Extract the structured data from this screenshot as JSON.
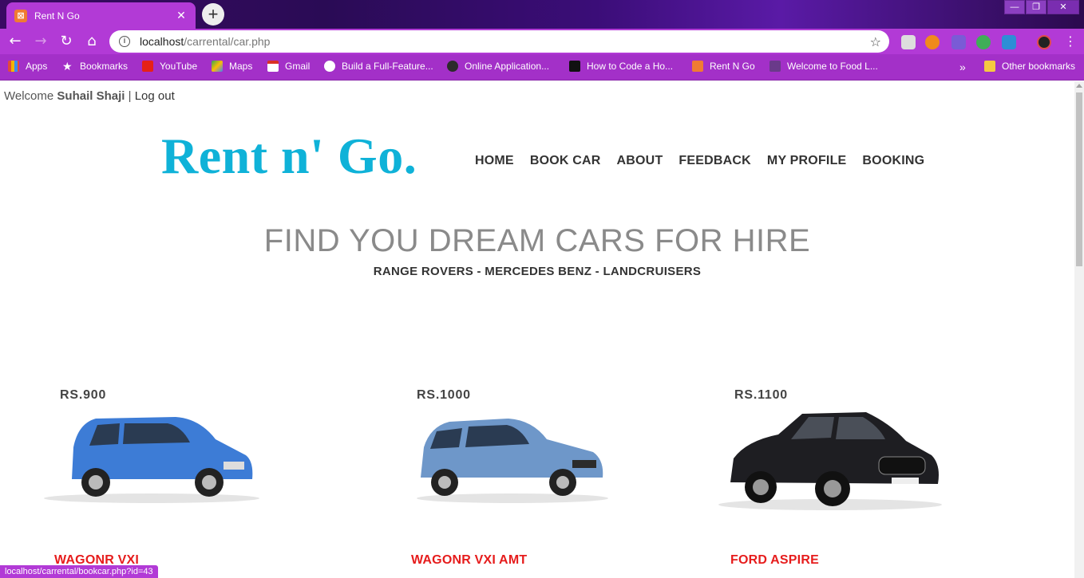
{
  "browser": {
    "tab_title": "Rent N Go",
    "url_host": "localhost",
    "url_path": "/carrental/car.php",
    "status_url": "localhost/carrental/bookcar.php?id=43",
    "bookmarks": [
      "Apps",
      "Bookmarks",
      "YouTube",
      "Maps",
      "Gmail",
      "Build a Full-Feature...",
      "Online Application...",
      "How to Code a Ho...",
      "Rent N Go",
      "Welcome to Food L...",
      "Other bookmarks"
    ],
    "overflow_label": "»"
  },
  "user": {
    "welcome_label": "Welcome",
    "name": "Suhail Shaji",
    "separator": "|",
    "logout_label": "Log out"
  },
  "site": {
    "logo": "Rent n' Go.",
    "nav": [
      "HOME",
      "BOOK CAR",
      "ABOUT",
      "FEEDBACK",
      "MY PROFILE",
      "BOOKING"
    ]
  },
  "hero": {
    "title": "FIND YOU DREAM CARS FOR HIRE",
    "subtitle": "RANGE ROVERS - MERCEDES BENZ - LANDCRUISERS"
  },
  "cars": [
    {
      "price": "RS.900",
      "name": "WAGONR VXI",
      "color": "#3d7cd6"
    },
    {
      "price": "RS.1000",
      "name": "WAGONR VXI AMT",
      "color": "#6e97c9"
    },
    {
      "price": "RS.1100",
      "name": "FORD ASPIRE",
      "color": "#1e1e22"
    }
  ]
}
